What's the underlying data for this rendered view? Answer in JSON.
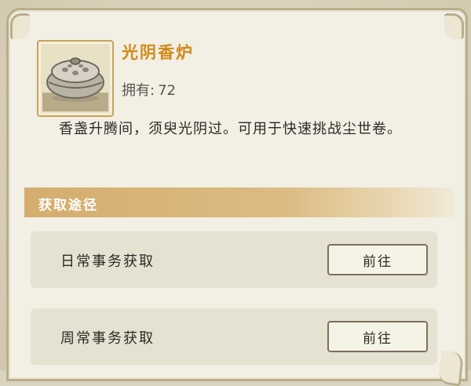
{
  "item": {
    "name": "光阴香炉",
    "owned_label": "拥有:",
    "owned_count": "72",
    "description": "香盏升腾间，须臾光阴过。可用于快速挑战尘世卷。",
    "icon": "incense-burner-icon"
  },
  "section": {
    "title": "获取途径"
  },
  "sources": [
    {
      "label": "日常事务获取",
      "button": "前往"
    },
    {
      "label": "周常事务获取",
      "button": "前往"
    }
  ],
  "colors": {
    "title": "#d08a1b",
    "section_bar": "#d4ad6e",
    "panel": "#f2efe4",
    "frame": "#c6a35e"
  }
}
